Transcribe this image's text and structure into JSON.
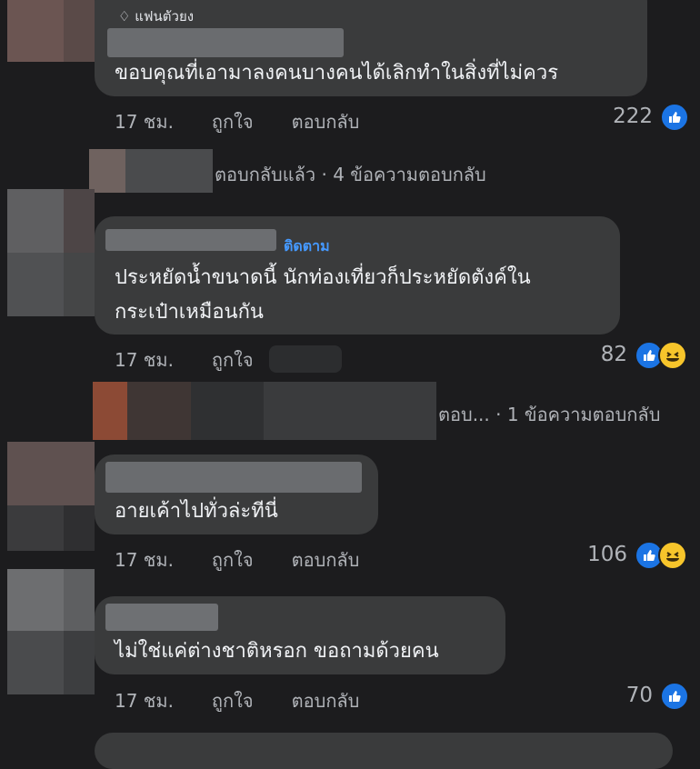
{
  "comments": [
    {
      "badge": "แฟนตัวยง",
      "text_lines": [
        "ขอบคุณที่เอามาลงคนบางคนได้เลิกทำในสิ่งที่ไม่ควร"
      ],
      "time": "17 ชม.",
      "like": "ถูกใจ",
      "reply": "ตอบกลับ",
      "count": "222",
      "reactions": [
        "like-icon"
      ],
      "replies": "ตอบกลับแล้ว · 4 ข้อความตอบกลับ"
    },
    {
      "follow": "ติดตาม",
      "text_lines": [
        "ประหยัดน้ำขนาดนี้ นักท่องเที่ยวก็ประหยัดตังค์ใน",
        "กระเป๋าเหมือนกัน"
      ],
      "time": "17 ชม.",
      "like": "ถูกใจ",
      "count": "82",
      "reactions": [
        "like-icon",
        "haha-icon"
      ],
      "replies": "ตอบ... · 1 ข้อความตอบกลับ"
    },
    {
      "text_lines": [
        "อายเค้าไปทั่วล่ะทีนี่"
      ],
      "time": "17 ชม.",
      "like": "ถูกใจ",
      "reply": "ตอบกลับ",
      "count": "106",
      "reactions": [
        "like-icon",
        "haha-icon"
      ]
    },
    {
      "text_lines": [
        "ไม่ใช่แค่ต่างชาติหรอก ขอถามด้วยคน"
      ],
      "time": "17 ชม.",
      "like": "ถูกใจ",
      "reply": "ตอบกลับ",
      "count": "70",
      "reactions": [
        "like-icon"
      ]
    }
  ],
  "colors": {
    "background": "#1c1c1e",
    "bubble": "#3a3b3c",
    "meta_text": "#b0b3b8",
    "like_blue": "#1b74e4",
    "follow_blue": "#4599ff"
  }
}
